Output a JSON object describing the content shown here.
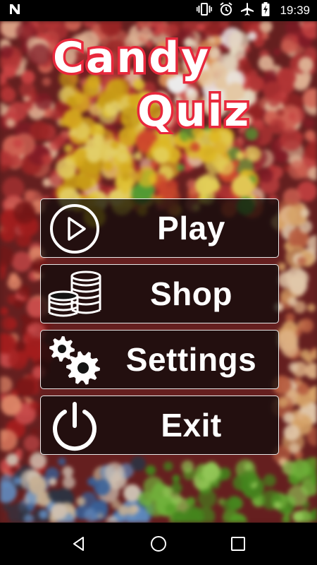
{
  "status_bar": {
    "time": "19:39",
    "icons": [
      "notification-n-icon",
      "vibrate-icon",
      "alarm-icon",
      "airplane-mode-icon",
      "battery-charging-icon"
    ]
  },
  "title": {
    "line1": "Candy",
    "line2": "Quiz",
    "text_color": "#ffffff",
    "outline_color": "#e8283c"
  },
  "menu": {
    "items": [
      {
        "label": "Play",
        "icon": "play-circle-icon"
      },
      {
        "label": "Shop",
        "icon": "coins-icon"
      },
      {
        "label": "Settings",
        "icon": "gears-icon"
      },
      {
        "label": "Exit",
        "icon": "power-icon"
      }
    ]
  },
  "nav_bar": {
    "buttons": [
      "back-icon",
      "home-icon",
      "recents-icon"
    ]
  }
}
